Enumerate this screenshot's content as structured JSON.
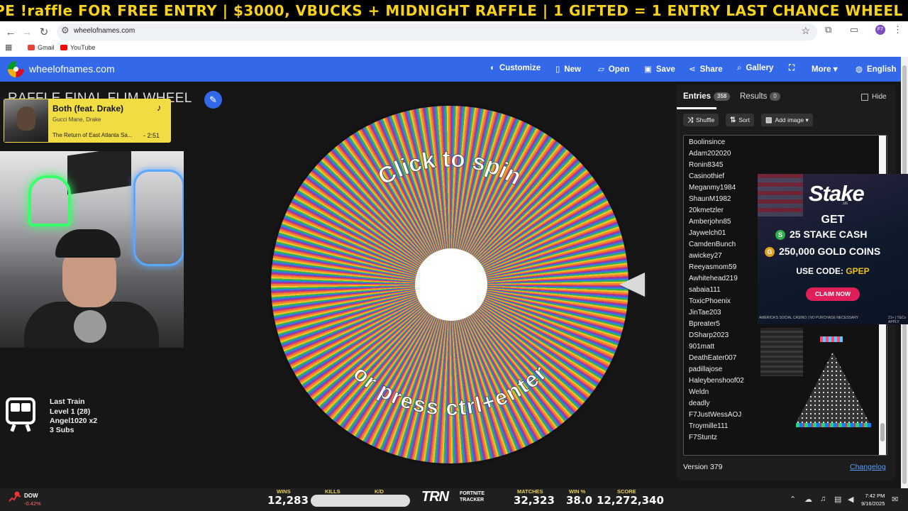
{
  "ticker": "PE !raffle FOR FREE ENTRY | $3000, VBUCKS + MIDNIGHT RAFFLE | 1 GIFTED = 1 ENTRY LAST CHANCE WHEEL | TYP",
  "browser": {
    "url": "wheelofnames.com",
    "profile_initials": "F7",
    "bookmarks": [
      {
        "label": "Gmail",
        "color": "#ea4335"
      },
      {
        "label": "YouTube",
        "color": "#ff0000"
      }
    ]
  },
  "app": {
    "brand": "wheelofnames.com",
    "menu": [
      {
        "label": "Customize",
        "icon": "palette-icon",
        "glyph": "🎨"
      },
      {
        "label": "New",
        "icon": "file-icon",
        "glyph": "🗋"
      },
      {
        "label": "Open",
        "icon": "folder-icon",
        "glyph": "📂"
      },
      {
        "label": "Save",
        "icon": "save-icon",
        "glyph": "💾"
      },
      {
        "label": "Share",
        "icon": "share-icon",
        "glyph": "⋔"
      },
      {
        "label": "Gallery",
        "icon": "search-icon",
        "glyph": "🔍"
      },
      {
        "label": "",
        "icon": "fullscreen-icon",
        "glyph": "⛶"
      },
      {
        "label": "More",
        "icon": "chevron-down-icon",
        "glyph": "▾"
      },
      {
        "label": "English",
        "icon": "globe-icon",
        "glyph": "🌐"
      }
    ],
    "wheel_title": "RAFFLE FINAL FLIM WHEEL",
    "wheel_text_top": "Click to spin",
    "wheel_text_bottom": "or press ctrl+enter"
  },
  "music": {
    "title": "Both (feat. Drake)",
    "artist": "Gucci Mane, Drake",
    "album": "The Return of East Atlanta Sa...",
    "time": "- 2:51"
  },
  "train": {
    "title": "Last Train",
    "level": "Level 1  (28)",
    "top": "Angel1020 x2",
    "subs": "3 Subs"
  },
  "panel": {
    "tab_entries": "Entries",
    "entries_count": "358",
    "tab_results": "Results",
    "results_count": "0",
    "hide_label": "Hide",
    "shuffle": "Shuffle",
    "sort": "Sort",
    "add_image": "Add image",
    "entries": [
      "Boolinsince",
      "Adam202020",
      "Ronin8345",
      "Casinothief",
      "Meganmy1984",
      "ShaunM1982",
      "20kmetzler",
      "Amberjohn85",
      "Jaywelch01",
      "CamdenBunch",
      "awickey27",
      "Reeyasmom59",
      "Awhitehead219",
      "sabaia111",
      "ToxicPhoenix",
      "JinTae203",
      "Bpreater5",
      "DSharp2023",
      "901matt",
      "DeathEater007",
      "padillajose",
      "Haleybenshoof02",
      "Weldn",
      "deadly",
      "F7JustWessAOJ",
      "Troymille111",
      "F7Stuntz"
    ],
    "version": "Version 379",
    "changelog": "Changelog"
  },
  "ad": {
    "logo": "Stake",
    "logo_sub": ".us",
    "get": "GET",
    "line1": "25 STAKE CASH",
    "line2": "250,000 GOLD COINS",
    "code_label": "USE CODE: ",
    "code": "GPEP",
    "claim": "CLAIM NOW",
    "foot_left": "AMERICA'S SOCIAL CASINO  |  NO PURCHASE NECESSARY",
    "foot_right": "21+ | T&Cs APPLY"
  },
  "stats": {
    "stock_name": "DOW",
    "stock_change": "-0.42%",
    "wins_label": "WINS",
    "wins": "12,283",
    "kills_label": "KILLS",
    "kd_label": "K/D",
    "tracker_brand": "TRN",
    "tracker_name": "FORTNITE TRACKER",
    "matches_label": "MATCHES",
    "matches": "32,323",
    "winpct_label": "WIN %",
    "winpct": "38.0",
    "score_label": "SCORE",
    "score": "12,272,340"
  },
  "clock": {
    "time": "7:42 PM",
    "date": "9/16/2025"
  },
  "colors": {
    "accent": "#3369e8",
    "ticker": "#f6d21a",
    "music_bg": "#f2dc44",
    "ad_claim": "#e01e5a"
  }
}
